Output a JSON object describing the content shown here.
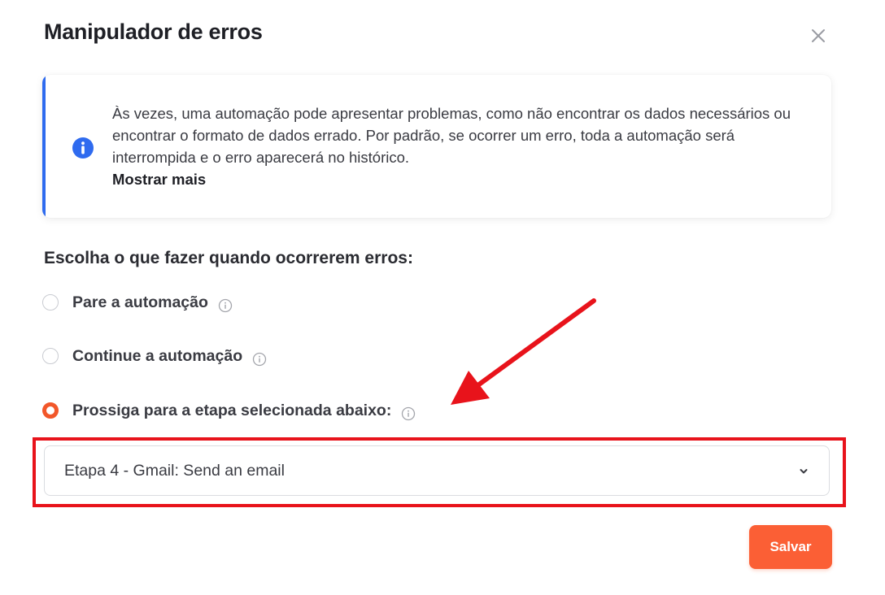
{
  "dialog": {
    "title": "Manipulador de erros",
    "close_icon": "close-icon"
  },
  "info": {
    "icon": "info-icon",
    "text": "Às vezes, uma automação pode apresentar problemas, como não encontrar os dados necessários ou encontrar o formato de dados errado. Por padrão, se ocorrer um erro, toda a automação será interrompida e o erro aparecerá no histórico.",
    "show_more_label": "Mostrar mais",
    "accent_color": "#2f6bef"
  },
  "options": {
    "heading": "Escolha o que fazer quando ocorrerem erros:",
    "items": [
      {
        "label": "Pare a automação",
        "selected": false,
        "help_icon": "help-icon"
      },
      {
        "label": "Continue a automação",
        "selected": false,
        "help_icon": "help-icon"
      },
      {
        "label": "Prossiga para a etapa selecionada abaixo:",
        "selected": true,
        "help_icon": "help-icon"
      }
    ],
    "selected_color": "#f2572a"
  },
  "step_select": {
    "value": "Etapa 4 - Gmail: Send an email",
    "icon": "chevron-down-icon"
  },
  "annotation": {
    "arrow_color": "#e8131b",
    "frame_color": "#e8131b"
  },
  "footer": {
    "save_label": "Salvar",
    "save_color": "#fb5f35"
  }
}
